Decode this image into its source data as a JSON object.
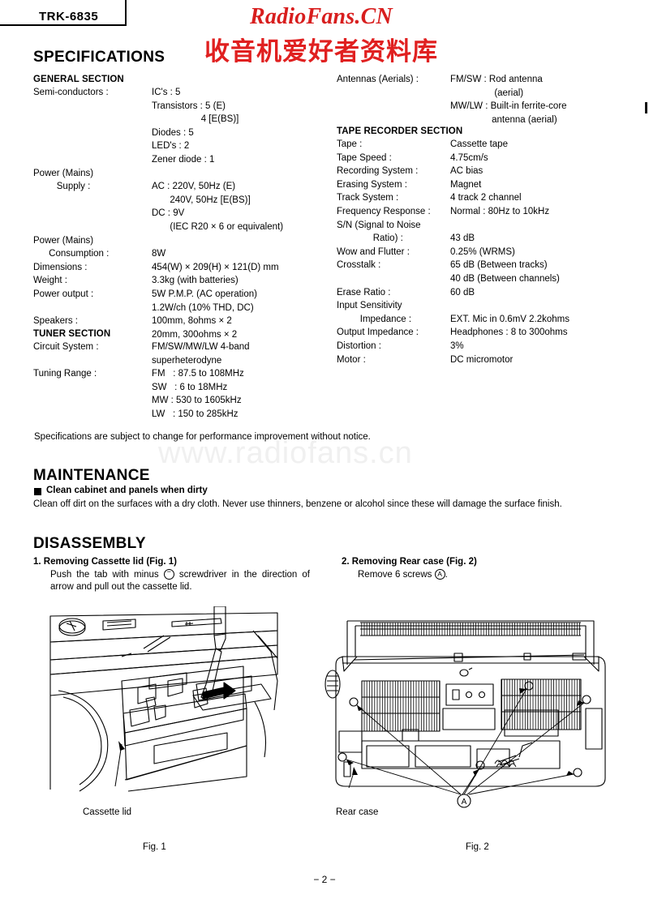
{
  "header": {
    "model": "TRK-6835",
    "watermark_latin": "RadioFans.CN",
    "watermark_cjk": "收音机爱好者资料库",
    "watermark_faint": "www.radiofans.cn",
    "watermark_color": "#d81e1e"
  },
  "specifications": {
    "title": "SPECIFICATIONS",
    "general": {
      "heading": "GENERAL SECTION",
      "rows": [
        {
          "label": "Semi-conductors :",
          "value": "IC's : 5"
        },
        {
          "label": "",
          "value": "Transistors : 5 (E)"
        },
        {
          "label": "",
          "value": "                   4 [E(BS)]"
        },
        {
          "label": "",
          "value": "Diodes : 5"
        },
        {
          "label": "",
          "value": "LED's : 2"
        },
        {
          "label": "",
          "value": "Zener diode : 1"
        },
        {
          "label": "Power (Mains)",
          "value": ""
        },
        {
          "label": "         Supply :",
          "value": "AC : 220V, 50Hz (E)"
        },
        {
          "label": "",
          "value": "       240V, 50Hz [E(BS)]"
        },
        {
          "label": "",
          "value": "DC : 9V"
        },
        {
          "label": "",
          "value": "       (IEC R20 × 6 or equivalent)"
        },
        {
          "label": "Power (Mains)",
          "value": ""
        },
        {
          "label": "      Consumption :",
          "value": "8W"
        },
        {
          "label": "Dimensions :",
          "value": "454(W) × 209(H) × 121(D) mm"
        },
        {
          "label": "Weight :",
          "value": "3.3kg (with batteries)"
        },
        {
          "label": "Power output :",
          "value": "5W P.M.P. (AC operation)"
        },
        {
          "label": "",
          "value": "1.2W/ch (10% THD, DC)"
        },
        {
          "label": "Speakers :",
          "value": "100mm, 8ohms × 2"
        },
        {
          "label": "",
          "value": "20mm, 300ohms × 2"
        }
      ]
    },
    "tuner": {
      "heading": "TUNER SECTION",
      "rows": [
        {
          "label": "Circuit System :",
          "value": "FM/SW/MW/LW 4-band"
        },
        {
          "label": "",
          "value": "superheterodyne"
        },
        {
          "label": "Tuning Range :",
          "value": "FM   : 87.5 to 108MHz"
        },
        {
          "label": "",
          "value": "SW   : 6 to 18MHz"
        },
        {
          "label": "",
          "value": "MW : 530 to 1605kHz"
        },
        {
          "label": "",
          "value": "LW   : 150 to 285kHz"
        }
      ]
    },
    "antennas": {
      "rows": [
        {
          "label": "Antennas (Aerials) :",
          "value": "FM/SW : Rod antenna"
        },
        {
          "label": "",
          "value": "                 (aerial)"
        },
        {
          "label": "",
          "value": "MW/LW : Built-in ferrite-core"
        },
        {
          "label": "",
          "value": "                antenna (aerial)"
        }
      ]
    },
    "tape_recorder": {
      "heading": "TAPE RECORDER SECTION",
      "rows": [
        {
          "label": "Tape :",
          "value": "Cassette tape"
        },
        {
          "label": "Tape Speed :",
          "value": "4.75cm/s"
        },
        {
          "label": "Recording System :",
          "value": "AC bias"
        },
        {
          "label": "Erasing System :",
          "value": "Magnet"
        },
        {
          "label": "Track System :",
          "value": "4 track 2 channel"
        },
        {
          "label": "Frequency Response :",
          "value": "Normal : 80Hz to 10kHz"
        },
        {
          "label": "S/N (Signal to Noise",
          "value": ""
        },
        {
          "label": "              Ratio) :",
          "value": "43 dB"
        },
        {
          "label": "Wow and Flutter :",
          "value": "0.25% (WRMS)"
        },
        {
          "label": "Crosstalk :",
          "value": "65 dB (Between tracks)"
        },
        {
          "label": "",
          "value": "40 dB (Between channels)"
        },
        {
          "label": "Erase Ratio :",
          "value": "60 dB"
        },
        {
          "label": "Input Sensitivity",
          "value": ""
        },
        {
          "label": "         Impedance :",
          "value": "EXT. Mic in 0.6mV 2.2kohms"
        },
        {
          "label": "Output Impedance :",
          "value": "Headphones : 8 to 300ohms"
        },
        {
          "label": "Distortion :",
          "value": "3%"
        },
        {
          "label": "Motor :",
          "value": "DC micromotor"
        }
      ]
    },
    "note": "Specifications are subject to change for performance improvement without notice."
  },
  "maintenance": {
    "title": "MAINTENANCE",
    "subtitle": "Clean cabinet and panels when dirty",
    "body": "Clean off dirt on the surfaces with a dry cloth. Never use thinners, benzene or alcohol since these will damage the surface finish."
  },
  "disassembly": {
    "title": "DISASSEMBLY",
    "step1": {
      "number": "1.",
      "title": "Removing Cassette lid (Fig. 1)",
      "body_before": "Push  the  tab  with  minus",
      "symbol": "−",
      "body_after": "screwdriver  in  the direction of arrow and pull out the cassette lid."
    },
    "step2": {
      "number": "2.",
      "title": "Removing Rear case (Fig. 2)",
      "body_before": "Remove 6 screws",
      "symbol": "A",
      "body_after": "."
    }
  },
  "figures": [
    {
      "caption": "Fig. 1",
      "callout": "Cassette lid"
    },
    {
      "caption": "Fig. 2",
      "callout": "Rear case",
      "screw_label": "A"
    }
  ],
  "footer": {
    "page": "− 2 −"
  }
}
